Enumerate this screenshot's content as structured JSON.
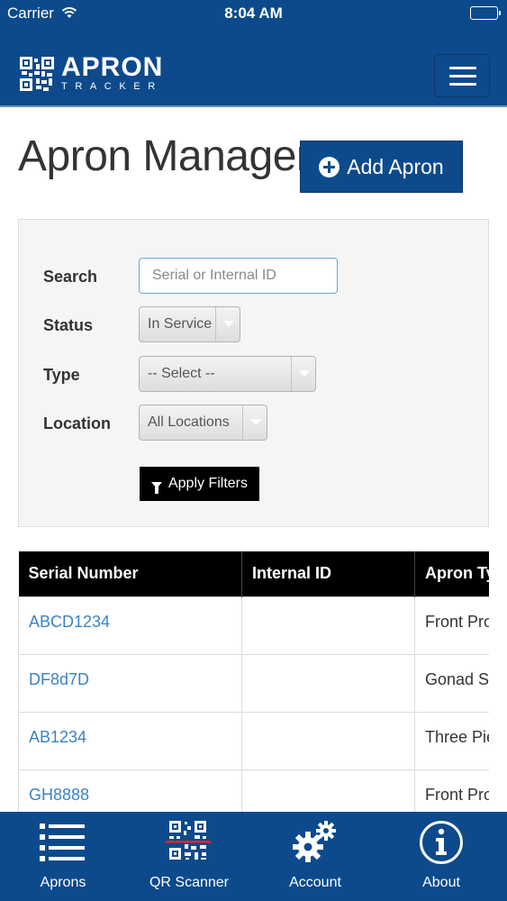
{
  "status_bar": {
    "carrier": "Carrier",
    "time": "8:04 AM"
  },
  "header": {
    "brand_name": "APRON",
    "brand_tm": "™",
    "brand_tagline": "TRACKER",
    "menu_icon": "hamburger-icon"
  },
  "page": {
    "title": "Apron Manager",
    "add_button_label": "Add Apron",
    "add_button_icon": "plus-circle-icon"
  },
  "filters": {
    "search_label": "Search",
    "search_placeholder": "Serial or Internal ID",
    "search_value": "",
    "status_label": "Status",
    "status_value": "In Service",
    "type_label": "Type",
    "type_value": "-- Select --",
    "location_label": "Location",
    "location_value": "All Locations",
    "apply_label": "Apply Filters",
    "apply_icon": "filter-icon"
  },
  "table": {
    "columns": [
      "Serial Number",
      "Internal ID",
      "Apron Ty"
    ],
    "rows": [
      {
        "serial": "ABCD1234",
        "internal_id": "",
        "apron_type": "Front Pro"
      },
      {
        "serial": "DF8d7D",
        "internal_id": "",
        "apron_type": "Gonad Sh"
      },
      {
        "serial": "AB1234",
        "internal_id": "",
        "apron_type": "Three Pie"
      },
      {
        "serial": "GH8888",
        "internal_id": "",
        "apron_type": "Front Pro"
      }
    ]
  },
  "tab_bar": {
    "items": [
      {
        "label": "Aprons",
        "icon": "list-icon"
      },
      {
        "label": "QR Scanner",
        "icon": "qr-code-icon"
      },
      {
        "label": "Account",
        "icon": "gears-icon"
      },
      {
        "label": "About",
        "icon": "info-icon"
      }
    ]
  },
  "colors": {
    "brand_blue": "#0d4a8c",
    "link_blue": "#3a83c5",
    "header_black": "#000000",
    "accent_red": "#d9272e"
  }
}
